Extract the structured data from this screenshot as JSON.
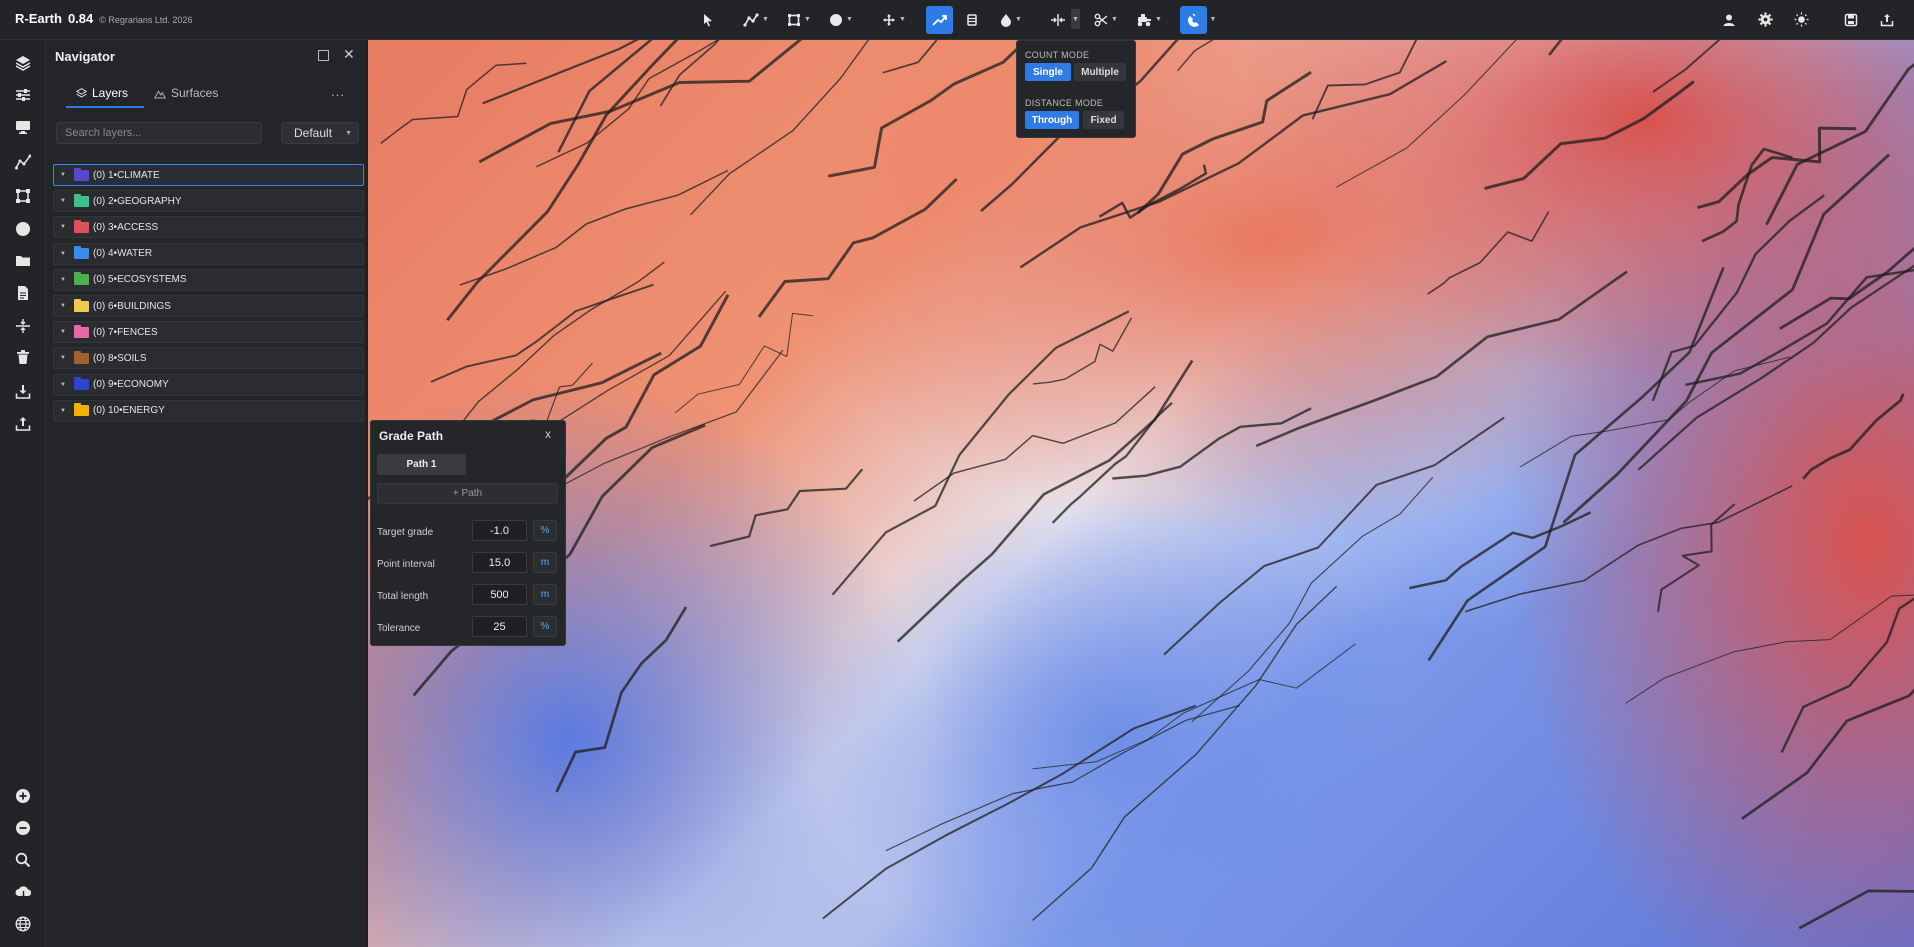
{
  "app": {
    "name": "R-Earth",
    "version": "0.84",
    "copyright": "© Regrarians Ltd. 2026"
  },
  "toolbar": {
    "tools": [
      {
        "name": "select-tool",
        "icon": "cursor-icon"
      },
      {
        "name": "polyline-tool",
        "icon": "polyline-icon"
      },
      {
        "name": "polygon-tool",
        "icon": "polygon-icon"
      },
      {
        "name": "circle-tool",
        "icon": "circle-icon"
      },
      {
        "name": "move-tool",
        "icon": "move-icon"
      },
      {
        "name": "grade-path-tool",
        "icon": "grade-path-icon",
        "active": true
      },
      {
        "name": "drum-tool",
        "icon": "drum-icon"
      },
      {
        "name": "water-tool",
        "icon": "water-drop-icon"
      },
      {
        "name": "split-tool",
        "icon": "split-icon"
      },
      {
        "name": "cut-tool",
        "icon": "scissors-icon"
      },
      {
        "name": "tractor-tool",
        "icon": "tractor-icon"
      },
      {
        "name": "snap-tool",
        "icon": "magnet-icon",
        "active": true
      }
    ],
    "right": [
      "user-icon",
      "settings-icon",
      "theme-icon",
      "save-icon",
      "export-icon"
    ]
  },
  "sidebar": {
    "icons": [
      "layers-icon",
      "sliders-icon",
      "monitor-icon",
      "line-chart-icon",
      "nodes-icon",
      "circle-icon",
      "folder-icon",
      "document-icon",
      "split-vertical-icon",
      "trash-icon",
      "download-icon",
      "upload-icon",
      "zoom-in-icon",
      "zoom-out-icon",
      "search-icon",
      "cloud-download-icon",
      "globe-icon"
    ]
  },
  "navigator": {
    "title": "Navigator",
    "tabs": [
      {
        "label": "Layers"
      },
      {
        "label": "Surfaces"
      }
    ],
    "more": "...",
    "search_placeholder": "Search layers...",
    "select_value": "Default",
    "layers": [
      {
        "label": "(0) 1•CLIMATE",
        "color": "#5b47c9"
      },
      {
        "label": "(0) 2•GEOGRAPHY",
        "color": "#3fbf8a"
      },
      {
        "label": "(0) 3•ACCESS",
        "color": "#e0505a"
      },
      {
        "label": "(0) 4•WATER",
        "color": "#3d8be8"
      },
      {
        "label": "(0) 5•ECOSYSTEMS",
        "color": "#4caf50"
      },
      {
        "label": "(0) 6•BUILDINGS",
        "color": "#f2c94c"
      },
      {
        "label": "(0) 7•FENCES",
        "color": "#e56aa6"
      },
      {
        "label": "(0) 8•SOILS",
        "color": "#a0612b"
      },
      {
        "label": "(0) 9•ECONOMY",
        "color": "#2a47c9"
      },
      {
        "label": "(0) 10•ENERGY",
        "color": "#f0b400"
      }
    ]
  },
  "count_popup": {
    "count_mode_label": "COUNT MODE",
    "count_options": [
      "Single",
      "Multiple"
    ],
    "distance_mode_label": "DISTANCE MODE",
    "distance_options": [
      "Through",
      "Fixed"
    ]
  },
  "grade_path": {
    "title": "Grade Path",
    "close": "x",
    "path_tab": "Path 1",
    "add_path": "+ Path",
    "fields": [
      {
        "label": "Target grade",
        "value": "-1.0",
        "unit": "%"
      },
      {
        "label": "Point interval",
        "value": "15.0",
        "unit": "m"
      },
      {
        "label": "Total length",
        "value": "500",
        "unit": "m"
      },
      {
        "label": "Tolerance",
        "value": "25",
        "unit": "%"
      }
    ]
  }
}
